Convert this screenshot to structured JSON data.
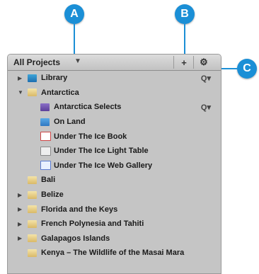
{
  "callouts": [
    "A",
    "B",
    "C"
  ],
  "panel": {
    "title": "All Projects",
    "add_button": "+",
    "action_button": "⚙"
  },
  "rows": [
    {
      "label": "Library",
      "level": 0,
      "expander": "▶",
      "icon": "library-icon",
      "search": "Q▾"
    },
    {
      "label": "Antarctica",
      "level": 0,
      "expander": "▼",
      "icon": "folder-icon"
    },
    {
      "label": "Antarctica Selects",
      "level": 1,
      "icon": "smart-album-icon",
      "search": "Q▾"
    },
    {
      "label": "On Land",
      "level": 1,
      "icon": "album-icon"
    },
    {
      "label": "Under The Ice Book",
      "level": 1,
      "icon": "book-icon"
    },
    {
      "label": "Under The Ice Light Table",
      "level": 1,
      "icon": "light-table-icon"
    },
    {
      "label": "Under The Ice Web Gallery",
      "level": 1,
      "icon": "web-gallery-icon"
    },
    {
      "label": "Bali",
      "level": 0,
      "icon": "project-icon"
    },
    {
      "label": "Belize",
      "level": 0,
      "expander": "▶",
      "icon": "project-icon"
    },
    {
      "label": "Florida and the Keys",
      "level": 0,
      "expander": "▶",
      "icon": "project-icon"
    },
    {
      "label": "French Polynesia and Tahiti",
      "level": 0,
      "expander": "▶",
      "icon": "project-icon"
    },
    {
      "label": "Galapagos Islands",
      "level": 0,
      "expander": "▶",
      "icon": "project-icon"
    },
    {
      "label": "Kenya – The Wildlife of the Masai Mara",
      "level": 0,
      "icon": "project-icon"
    }
  ]
}
